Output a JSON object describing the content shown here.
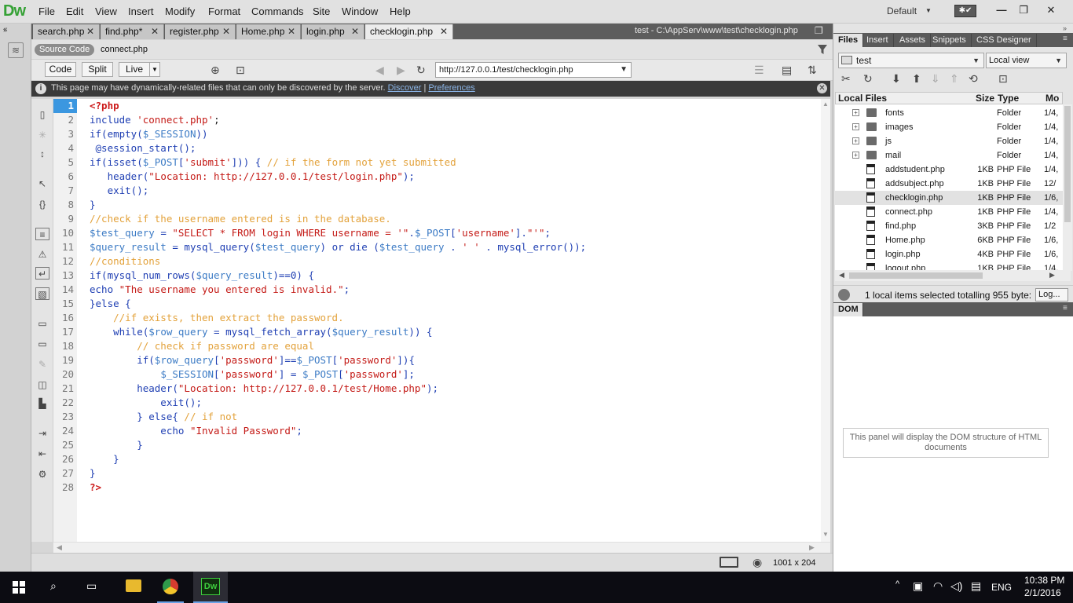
{
  "app": {
    "logo": "Dw"
  },
  "menu": [
    "File",
    "Edit",
    "View",
    "Insert",
    "Modify",
    "Format",
    "Commands",
    "Site",
    "Window",
    "Help"
  ],
  "workspace": "Default",
  "window_controls": {
    "minimize": "—",
    "restore": "❐",
    "close": "✕"
  },
  "doc_tabs": [
    {
      "label": "search.php"
    },
    {
      "label": "find.php*"
    },
    {
      "label": "register.php"
    },
    {
      "label": "Home.php"
    },
    {
      "label": "login.php"
    },
    {
      "label": "checklogin.php",
      "active": true
    }
  ],
  "doc_path": "test - C:\\AppServ\\www\\test\\checklogin.php",
  "related": {
    "source": "Source Code",
    "file": "connect.php"
  },
  "view_buttons": {
    "code": "Code",
    "split": "Split",
    "live": "Live"
  },
  "url": "http://127.0.0.1/test/checklogin.php",
  "info": {
    "text": "This page may have dynamically-related files that can only be discovered by the server.",
    "discover": "Discover",
    "sep": "|",
    "preferences": "Preferences"
  },
  "colors": {
    "kw": "#1f3fb3",
    "str": "#c41a16",
    "com": "#e3a23b",
    "var": "#3c7bc5",
    "tag": "#cc1a1a",
    "plain": "#1a1a1a"
  },
  "code_lines": [
    [
      [
        "tag",
        "<?php"
      ]
    ],
    [
      [
        "kw",
        "include "
      ],
      [
        "str",
        "'connect.php'"
      ],
      [
        "plain",
        ";"
      ]
    ],
    [
      [
        "kw",
        "if(empty("
      ],
      [
        "var",
        "$_SESSION"
      ],
      [
        "kw",
        "))"
      ]
    ],
    [
      [
        "kw",
        " @session_start();"
      ]
    ],
    [
      [
        "kw",
        "if(isset("
      ],
      [
        "var",
        "$_POST"
      ],
      [
        "kw",
        "["
      ],
      [
        "str",
        "'submit'"
      ],
      [
        "kw",
        "])) { "
      ],
      [
        "com",
        "// if the form not yet submitted"
      ]
    ],
    [
      [
        "kw",
        "   header("
      ],
      [
        "str",
        "\"Location: http://127.0.0.1/test/login.php\""
      ],
      [
        "kw",
        ");"
      ]
    ],
    [
      [
        "kw",
        "   exit();"
      ]
    ],
    [
      [
        "kw",
        "}"
      ]
    ],
    [
      [
        "com",
        "//check if the username entered is in the database."
      ]
    ],
    [
      [
        "var",
        "$test_query"
      ],
      [
        "kw",
        " = "
      ],
      [
        "str",
        "\"SELECT * FROM login WHERE username = '\""
      ],
      [
        "kw",
        "."
      ],
      [
        "var",
        "$_POST"
      ],
      [
        "kw",
        "["
      ],
      [
        "str",
        "'username'"
      ],
      [
        "kw",
        "]."
      ],
      [
        "str",
        "\"'\""
      ],
      [
        "kw",
        ";"
      ]
    ],
    [
      [
        "var",
        "$query_result"
      ],
      [
        "kw",
        " = mysql_query("
      ],
      [
        "var",
        "$test_query"
      ],
      [
        "kw",
        ") or die ("
      ],
      [
        "var",
        "$test_query"
      ],
      [
        "kw",
        " . "
      ],
      [
        "str",
        "' '"
      ],
      [
        "kw",
        " . mysql_error());"
      ]
    ],
    [
      [
        "com",
        "//conditions"
      ]
    ],
    [
      [
        "kw",
        "if(mysql_num_rows("
      ],
      [
        "var",
        "$query_result"
      ],
      [
        "kw",
        ")==0) {"
      ]
    ],
    [
      [
        "kw",
        "echo "
      ],
      [
        "str",
        "\"The username you entered is invalid.\""
      ],
      [
        "kw",
        ";"
      ]
    ],
    [
      [
        "kw",
        "}else {"
      ]
    ],
    [
      [
        "com",
        "    //if exists, then extract the password."
      ]
    ],
    [
      [
        "kw",
        "    while("
      ],
      [
        "var",
        "$row_query"
      ],
      [
        "kw",
        " = mysql_fetch_array("
      ],
      [
        "var",
        "$query_result"
      ],
      [
        "kw",
        ")) {"
      ]
    ],
    [
      [
        "com",
        "        // check if password are equal"
      ]
    ],
    [
      [
        "kw",
        "        if("
      ],
      [
        "var",
        "$row_query"
      ],
      [
        "kw",
        "["
      ],
      [
        "str",
        "'password'"
      ],
      [
        "kw",
        "]=="
      ],
      [
        "var",
        "$_POST"
      ],
      [
        "kw",
        "["
      ],
      [
        "str",
        "'password'"
      ],
      [
        "kw",
        "]){"
      ]
    ],
    [
      [
        "kw",
        "            "
      ],
      [
        "var",
        "$_SESSION"
      ],
      [
        "kw",
        "["
      ],
      [
        "str",
        "'password'"
      ],
      [
        "kw",
        "] = "
      ],
      [
        "var",
        "$_POST"
      ],
      [
        "kw",
        "["
      ],
      [
        "str",
        "'password'"
      ],
      [
        "kw",
        "];"
      ]
    ],
    [
      [
        "kw",
        "        header("
      ],
      [
        "str",
        "\"Location: http://127.0.0.1/test/Home.php\""
      ],
      [
        "kw",
        ");"
      ]
    ],
    [
      [
        "kw",
        "            exit();"
      ]
    ],
    [
      [
        "kw",
        "        } else{ "
      ],
      [
        "com",
        "// if not"
      ]
    ],
    [
      [
        "kw",
        "            echo "
      ],
      [
        "str",
        "\"Invalid Password\""
      ],
      [
        "kw",
        ";"
      ]
    ],
    [
      [
        "kw",
        "        }"
      ]
    ],
    [
      [
        "kw",
        "    }"
      ]
    ],
    [
      [
        "kw",
        "}"
      ]
    ],
    [
      [
        "tag",
        "?>"
      ]
    ]
  ],
  "status": {
    "size": "1001 x 204"
  },
  "panel_tabs": [
    "Files",
    "Insert",
    "Assets",
    "Snippets",
    "CSS Designer"
  ],
  "files": {
    "site": "test",
    "view": "Local view",
    "headers": {
      "name": "Local Files",
      "size": "Size",
      "type": "Type",
      "mod": "Mo"
    },
    "rows": [
      {
        "name": "fonts",
        "size": "",
        "type": "Folder",
        "mod": "1/4,",
        "kind": "folder"
      },
      {
        "name": "images",
        "size": "",
        "type": "Folder",
        "mod": "1/4,",
        "kind": "folder"
      },
      {
        "name": "js",
        "size": "",
        "type": "Folder",
        "mod": "1/4,",
        "kind": "folder"
      },
      {
        "name": "mail",
        "size": "",
        "type": "Folder",
        "mod": "1/4,",
        "kind": "folder"
      },
      {
        "name": "addstudent.php",
        "size": "1KB",
        "type": "PHP File",
        "mod": "1/4,",
        "kind": "file"
      },
      {
        "name": "addsubject.php",
        "size": "1KB",
        "type": "PHP File",
        "mod": "12/",
        "kind": "file"
      },
      {
        "name": "checklogin.php",
        "size": "1KB",
        "type": "PHP File",
        "mod": "1/6,",
        "kind": "file",
        "selected": true
      },
      {
        "name": "connect.php",
        "size": "1KB",
        "type": "PHP File",
        "mod": "1/4,",
        "kind": "file"
      },
      {
        "name": "find.php",
        "size": "3KB",
        "type": "PHP File",
        "mod": "1/2",
        "kind": "file"
      },
      {
        "name": "Home.php",
        "size": "6KB",
        "type": "PHP File",
        "mod": "1/6,",
        "kind": "file"
      },
      {
        "name": "login.php",
        "size": "4KB",
        "type": "PHP File",
        "mod": "1/6,",
        "kind": "file"
      },
      {
        "name": "logout.php",
        "size": "1KB",
        "type": "PHP File",
        "mod": "1/4,",
        "kind": "file"
      }
    ],
    "status": "1 local items selected totalling 955 byte:",
    "log": "Log..."
  },
  "dom": {
    "tab": "DOM",
    "message": "This panel will display the DOM structure of HTML documents"
  },
  "taskbar": {
    "time": "10:38 PM",
    "date": "2/1/2016",
    "lang": "ENG"
  }
}
